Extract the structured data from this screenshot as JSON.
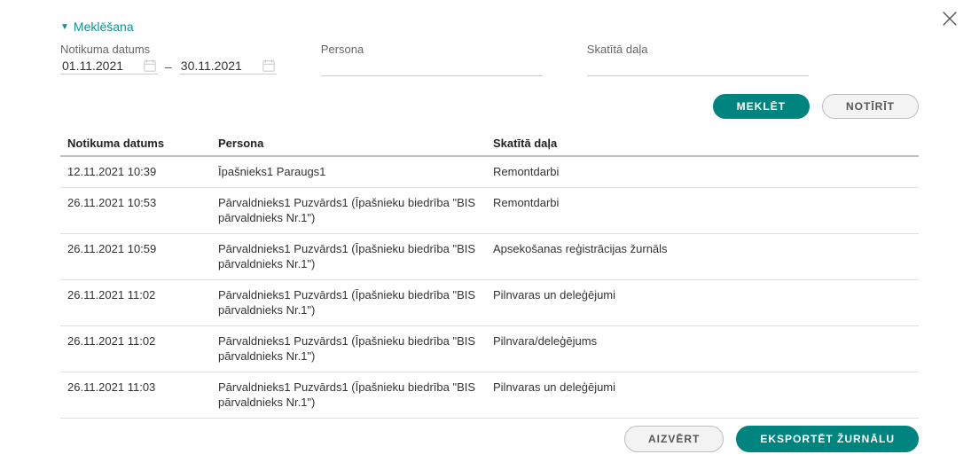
{
  "close_icon_name": "close-icon",
  "search_panel": {
    "title": "Meklēšana",
    "fields": {
      "date_label": "Notikuma datums",
      "date_from": "01.11.2021",
      "date_to": "30.11.2021",
      "date_sep": "–",
      "person_label": "Persona",
      "person_value": "",
      "section_label": "Skatītā daļa",
      "section_value": ""
    },
    "buttons": {
      "search": "MEKLĒT",
      "clear": "NOTĪRĪT"
    }
  },
  "table": {
    "headers": {
      "date": "Notikuma datums",
      "person": "Persona",
      "section": "Skatītā daļa"
    },
    "rows": [
      {
        "date": "12.11.2021 10:39",
        "person": "Īpašnieks1 Paraugs1",
        "section": "Remontdarbi"
      },
      {
        "date": "26.11.2021 10:53",
        "person": "Pārvaldnieks1 Puzvārds1 (Īpašnieku biedrība \"BIS pārvaldnieks Nr.1\")",
        "section": "Remontdarbi"
      },
      {
        "date": "26.11.2021 10:59",
        "person": "Pārvaldnieks1 Puzvārds1 (Īpašnieku biedrība \"BIS pārvaldnieks Nr.1\")",
        "section": "Apsekošanas reģistrācijas žurnāls"
      },
      {
        "date": "26.11.2021 11:02",
        "person": "Pārvaldnieks1 Puzvārds1 (Īpašnieku biedrība \"BIS pārvaldnieks Nr.1\")",
        "section": "Pilnvaras un deleģējumi"
      },
      {
        "date": "26.11.2021 11:02",
        "person": "Pārvaldnieks1 Puzvārds1 (Īpašnieku biedrība \"BIS pārvaldnieks Nr.1\")",
        "section": "Pilnvara/deleģējums"
      },
      {
        "date": "26.11.2021 11:03",
        "person": "Pārvaldnieks1 Puzvārds1 (Īpašnieku biedrība \"BIS pārvaldnieks Nr.1\")",
        "section": "Pilnvaras un deleģējumi"
      }
    ]
  },
  "footer": {
    "close": "AIZVĒRT",
    "export": "EKSPORTĒT ŽURNĀLU"
  }
}
